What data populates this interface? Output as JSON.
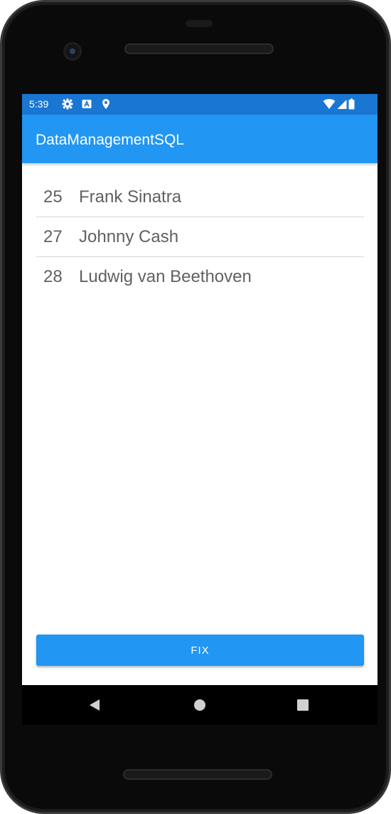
{
  "status_bar": {
    "time": "5:39",
    "icons_left": [
      "settings-icon",
      "a-notification-icon",
      "location-pin-icon"
    ],
    "icons_right": [
      "wifi-icon",
      "signal-icon",
      "battery-icon"
    ]
  },
  "app_bar": {
    "title": "DataManagementSQL"
  },
  "list": {
    "items": [
      {
        "id": "25",
        "name": "Frank Sinatra"
      },
      {
        "id": "27",
        "name": "Johnny Cash"
      },
      {
        "id": "28",
        "name": "Ludwig van Beethoven"
      }
    ]
  },
  "fix_button": {
    "label": "FIX"
  },
  "nav_bar": {
    "buttons": [
      "back-icon",
      "home-icon",
      "recents-icon"
    ]
  },
  "colors": {
    "status_bar": "#1976d2",
    "app_bar": "#2196f3",
    "button": "#2196f3",
    "text": "#616161"
  }
}
